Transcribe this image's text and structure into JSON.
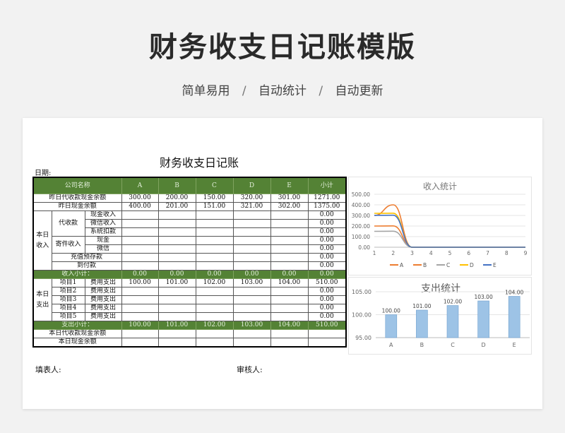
{
  "hero": {
    "title": "财务收支日记账模版",
    "tags": [
      "简单易用",
      "自动统计",
      "自动更新"
    ],
    "separator": "/"
  },
  "sheet": {
    "title": "财务收支日记账",
    "date_label": "日期:",
    "header": [
      "公司名称",
      "A",
      "B",
      "C",
      "D",
      "E",
      "小计"
    ],
    "prev_rows": [
      {
        "label": "昨日代收款现金余额",
        "values": [
          "300.00",
          "200.00",
          "150.00",
          "320.00",
          "301.00",
          "1271.00"
        ]
      },
      {
        "label": "昨日现金余额",
        "values": [
          "400.00",
          "201.00",
          "151.00",
          "321.00",
          "302.00",
          "1375.00"
        ]
      }
    ],
    "income_group": "本日收入",
    "income_groups": {
      "daishou": "代收款",
      "jicun": "寄件收入"
    },
    "income_rows": [
      {
        "label": "现金收入",
        "total": "0.00"
      },
      {
        "label": "微信收入",
        "total": "0.00"
      },
      {
        "label": "系统扣款",
        "total": "0.00"
      },
      {
        "label": "现金",
        "total": "0.00"
      },
      {
        "label": "微信",
        "total": "0.00"
      },
      {
        "label": "充值预存款",
        "total": "0.00"
      },
      {
        "label": "到付款",
        "total": "0.00"
      }
    ],
    "income_subtotal": {
      "label": "收入小计：",
      "values": [
        "0.00",
        "0.00",
        "0.00",
        "0.00",
        "0.00",
        "0.00"
      ]
    },
    "expense_group": "本日支出",
    "expense_rows": [
      {
        "item": "项目1",
        "type": "费用支出",
        "values": [
          "100.00",
          "101.00",
          "102.00",
          "103.00",
          "104.00",
          "510.00"
        ]
      },
      {
        "item": "项目2",
        "type": "费用支出",
        "values": [
          "",
          "",
          "",
          "",
          "",
          "0.00"
        ]
      },
      {
        "item": "项目3",
        "type": "费用支出",
        "values": [
          "",
          "",
          "",
          "",
          "",
          "0.00"
        ]
      },
      {
        "item": "项目4",
        "type": "费用支出",
        "values": [
          "",
          "",
          "",
          "",
          "",
          "0.00"
        ]
      },
      {
        "item": "项目5",
        "type": "费用支出",
        "values": [
          "",
          "",
          "",
          "",
          "",
          "0.00"
        ]
      }
    ],
    "expense_subtotal": {
      "label": "支出小计：",
      "values": [
        "100.00",
        "101.00",
        "102.00",
        "103.00",
        "104.00",
        "510.00"
      ]
    },
    "today_rows": [
      {
        "label": "本日代收款现金余额"
      },
      {
        "label": "本日现金余额"
      }
    ],
    "filler_label": "填表人:",
    "reviewer_label": "审核人:"
  },
  "chart_data": [
    {
      "type": "line",
      "title": "收入统计",
      "x": [
        1,
        2,
        3,
        4,
        5,
        6,
        7,
        8,
        9
      ],
      "ylim": [
        0,
        500
      ],
      "yticks": [
        "0.00",
        "100.00",
        "200.00",
        "300.00",
        "400.00",
        "500.00"
      ],
      "grid": true,
      "legend": "bottom",
      "series": [
        {
          "name": "A",
          "color": "#ed7d31",
          "values": [
            300,
            400,
            0,
            0,
            0,
            0,
            0,
            0,
            0
          ]
        },
        {
          "name": "B",
          "color": "#ed7d31",
          "values": [
            200,
            201,
            0,
            0,
            0,
            0,
            0,
            0,
            0
          ]
        },
        {
          "name": "C",
          "color": "#a5a5a5",
          "values": [
            150,
            151,
            0,
            0,
            0,
            0,
            0,
            0,
            0
          ]
        },
        {
          "name": "D",
          "color": "#ffc000",
          "values": [
            320,
            321,
            0,
            0,
            0,
            0,
            0,
            0,
            0
          ]
        },
        {
          "name": "E",
          "color": "#4472c4",
          "values": [
            301,
            302,
            0,
            0,
            0,
            0,
            0,
            0,
            0
          ]
        }
      ]
    },
    {
      "type": "bar",
      "title": "支出统计",
      "categories": [
        "A",
        "B",
        "C",
        "D",
        "E"
      ],
      "values": [
        100,
        101,
        102,
        103,
        104
      ],
      "labels": [
        "100.00",
        "101.00",
        "102.00",
        "103.00",
        "104.00"
      ],
      "ylim": [
        95,
        105
      ],
      "yticks": [
        "95.00",
        "100.00",
        "105.00"
      ],
      "bar_color": "#9dc3e6"
    }
  ]
}
